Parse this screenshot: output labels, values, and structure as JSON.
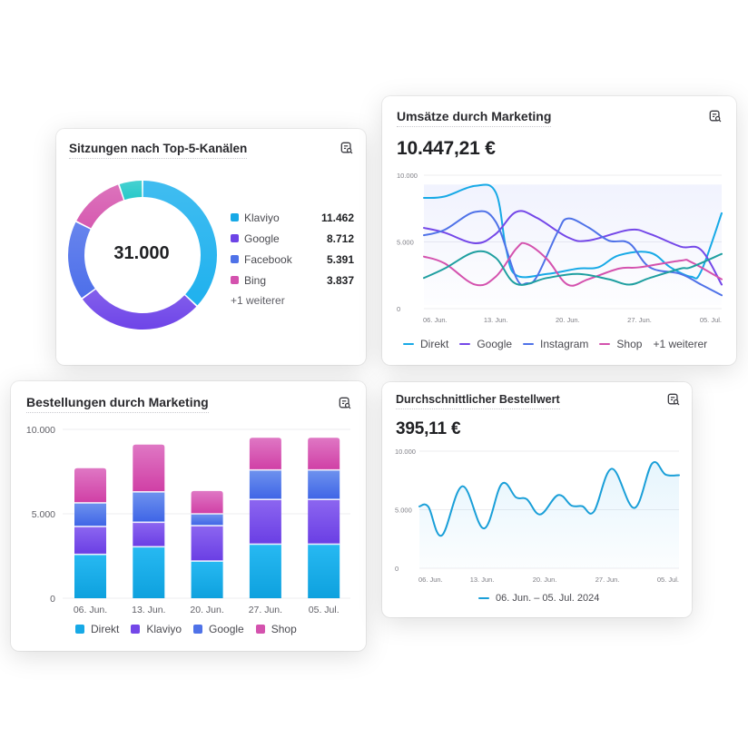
{
  "cards": {
    "donut": {
      "title": "Sitzungen nach Top-5-Kanälen",
      "icon": "report-search-icon",
      "total": "31.000",
      "legend": [
        {
          "label": "Klaviyo",
          "value": "11.462",
          "color": "#17a9e6"
        },
        {
          "label": "Google",
          "value": "8.712",
          "color": "#6d44e6"
        },
        {
          "label": "Facebook",
          "value": "5.391",
          "color": "#4f72e8"
        },
        {
          "label": "Bing",
          "value": "3.837",
          "color": "#d452ae"
        }
      ],
      "more_label": "+1 weiterer"
    },
    "revenue": {
      "title": "Umsätze durch Marketing",
      "icon": "report-search-icon",
      "value": "10.447,21 €",
      "legend": [
        {
          "label": "Direkt",
          "color": "#17a9e6"
        },
        {
          "label": "Google",
          "color": "#6d44e6"
        },
        {
          "label": "Instagram",
          "color": "#4f72e8"
        },
        {
          "label": "Shop",
          "color": "#d452ae"
        }
      ],
      "more_label": "+1 weiterer"
    },
    "orders": {
      "title": "Bestellungen durch Marketing",
      "icon": "report-search-icon",
      "legend": [
        {
          "label": "Direkt",
          "color": "#17a9e6"
        },
        {
          "label": "Klaviyo",
          "color": "#7447e8"
        },
        {
          "label": "Google",
          "color": "#4f72e8"
        },
        {
          "label": "Shop",
          "color": "#d452ae"
        }
      ]
    },
    "aov": {
      "title": "Durchschnittlicher Bestellwert",
      "icon": "report-search-icon",
      "value": "395,11 €",
      "legend_label": "06. Jun. – 05. Jul. 2024",
      "legend_color": "#1a9fd8"
    }
  },
  "chart_data": [
    {
      "id": "sessions-donut",
      "type": "pie",
      "title": "Sitzungen nach Top-5-Kanälen",
      "center_label": "31.000",
      "slices": [
        {
          "label": "Klaviyo",
          "value": 11462,
          "color": "#1fb1ee"
        },
        {
          "label": "Google",
          "value": 8712,
          "color": "#6e44e8"
        },
        {
          "label": "Facebook",
          "value": 5391,
          "color": "#4d6fea"
        },
        {
          "label": "Bing",
          "value": 3837,
          "color": "#d65ab0"
        },
        {
          "label": "Weitere",
          "value": 1598,
          "color": "#26c9c9"
        }
      ]
    },
    {
      "id": "revenue-lines",
      "type": "line",
      "title": "Umsätze durch Marketing",
      "xlabel": "",
      "ylabel": "",
      "x_range_days": [
        0,
        29
      ],
      "x_ticks": [
        {
          "day": 0,
          "label": "06. Jun."
        },
        {
          "day": 7,
          "label": "13. Jun."
        },
        {
          "day": 14,
          "label": "20. Jun."
        },
        {
          "day": 21,
          "label": "27. Jun."
        },
        {
          "day": 29,
          "label": "05. Jul."
        }
      ],
      "y_ticks": [
        {
          "value": 0,
          "label": "0"
        },
        {
          "value": 5000,
          "label": "5.000"
        },
        {
          "value": 10000,
          "label": "10.000"
        }
      ],
      "ylim": [
        0,
        10000
      ],
      "grid": true,
      "legend_position": "bottom",
      "series": [
        {
          "name": "Direkt",
          "color": "#17a9e6",
          "points": [
            [
              0,
              8300
            ],
            [
              2,
              8400
            ],
            [
              5,
              9200
            ],
            [
              7,
              8700
            ],
            [
              8,
              4500
            ],
            [
              9,
              2500
            ],
            [
              12,
              2600
            ],
            [
              15,
              3000
            ],
            [
              17,
              3100
            ],
            [
              19,
              4000
            ],
            [
              22,
              4200
            ],
            [
              24,
              3100
            ],
            [
              26,
              2400
            ],
            [
              27,
              2800
            ],
            [
              29,
              7150
            ]
          ]
        },
        {
          "name": "Google",
          "color": "#7447e8",
          "points": [
            [
              0,
              6050
            ],
            [
              2,
              5700
            ],
            [
              5,
              4900
            ],
            [
              7,
              5600
            ],
            [
              9,
              7250
            ],
            [
              11,
              6800
            ],
            [
              14,
              5350
            ],
            [
              16,
              5100
            ],
            [
              20,
              5900
            ],
            [
              22,
              5600
            ],
            [
              25,
              4650
            ],
            [
              27,
              4400
            ],
            [
              29,
              1800
            ]
          ]
        },
        {
          "name": "Instagram",
          "color": "#4f72e8",
          "points": [
            [
              0,
              5500
            ],
            [
              2,
              5900
            ],
            [
              5,
              7250
            ],
            [
              7,
              6500
            ],
            [
              9,
              2300
            ],
            [
              10,
              1900
            ],
            [
              11,
              2400
            ],
            [
              13,
              5700
            ],
            [
              14,
              6750
            ],
            [
              16,
              6100
            ],
            [
              18,
              5100
            ],
            [
              20,
              4900
            ],
            [
              22,
              3100
            ],
            [
              25,
              2600
            ],
            [
              27,
              1800
            ],
            [
              29,
              1000
            ]
          ]
        },
        {
          "name": "Shop",
          "color": "#d452ae",
          "points": [
            [
              0,
              3900
            ],
            [
              2,
              3400
            ],
            [
              5,
              1800
            ],
            [
              7,
              2400
            ],
            [
              9,
              4500
            ],
            [
              10,
              4850
            ],
            [
              12,
              3700
            ],
            [
              14,
              1800
            ],
            [
              16,
              2200
            ],
            [
              19,
              3000
            ],
            [
              21,
              3100
            ],
            [
              25,
              3600
            ],
            [
              26,
              3500
            ],
            [
              29,
              2200
            ]
          ]
        },
        {
          "name": "Weitere",
          "color": "#1f9fa0",
          "points": [
            [
              0,
              2300
            ],
            [
              2,
              3000
            ],
            [
              5,
              4250
            ],
            [
              7,
              3800
            ],
            [
              9,
              1850
            ],
            [
              12,
              2300
            ],
            [
              15,
              2600
            ],
            [
              18,
              2200
            ],
            [
              20,
              1800
            ],
            [
              22,
              2300
            ],
            [
              25,
              3000
            ],
            [
              26,
              3100
            ],
            [
              29,
              4100
            ]
          ]
        }
      ]
    },
    {
      "id": "orders-bars",
      "type": "bar",
      "stacked": true,
      "title": "Bestellungen durch Marketing",
      "categories": [
        "06. Jun.",
        "13. Jun.",
        "20. Jun.",
        "27. Jun.",
        "05. Jul."
      ],
      "y_ticks": [
        {
          "value": 0,
          "label": "0"
        },
        {
          "value": 5000,
          "label": "5.000"
        },
        {
          "value": 10000,
          "label": "10.000"
        }
      ],
      "ylim": [
        0,
        10000
      ],
      "grid": true,
      "legend_position": "bottom",
      "series": [
        {
          "name": "Direkt",
          "color_top": "#27b9f2",
          "color_bottom": "#0ea1de",
          "values": [
            2600,
            3050,
            2200,
            3200,
            3200
          ]
        },
        {
          "name": "Klaviyo",
          "color_top": "#8c66f0",
          "color_bottom": "#6a3ee4",
          "values": [
            1650,
            1450,
            2100,
            2650,
            2650
          ]
        },
        {
          "name": "Google",
          "color_top": "#6f93ee",
          "color_bottom": "#3e64e6",
          "values": [
            1400,
            1800,
            700,
            1750,
            1750
          ]
        },
        {
          "name": "Shop",
          "color_top": "#df77c4",
          "color_bottom": "#d03fa5",
          "values": [
            2050,
            2800,
            1350,
            1900,
            1900
          ]
        }
      ]
    },
    {
      "id": "aov-line",
      "type": "line",
      "title": "Durchschnittlicher Bestellwert",
      "x_range_days": [
        0,
        29
      ],
      "x_ticks": [
        {
          "day": 0,
          "label": "06. Jun."
        },
        {
          "day": 7,
          "label": "13. Jun."
        },
        {
          "day": 14,
          "label": "20. Jun."
        },
        {
          "day": 21,
          "label": "27. Jun."
        },
        {
          "day": 29,
          "label": "05. Jul."
        }
      ],
      "y_ticks": [
        {
          "value": 0,
          "label": "0"
        },
        {
          "value": 5000,
          "label": "5.000"
        },
        {
          "value": 10000,
          "label": "10.000"
        }
      ],
      "ylim": [
        0,
        10000
      ],
      "grid": true,
      "legend_position": "bottom",
      "series": [
        {
          "name": "06. Jun. – 05. Jul. 2024",
          "color": "#1a9fd8",
          "points": [
            [
              0,
              5280
            ],
            [
              1,
              5250
            ],
            [
              2.5,
              2800
            ],
            [
              4.8,
              7000
            ],
            [
              7.2,
              3400
            ],
            [
              9.2,
              7200
            ],
            [
              10.8,
              6050
            ],
            [
              12,
              5900
            ],
            [
              13.5,
              4600
            ],
            [
              15.5,
              6250
            ],
            [
              17,
              5350
            ],
            [
              18.2,
              5300
            ],
            [
              19.5,
              4850
            ],
            [
              21.5,
              8500
            ],
            [
              24,
              5150
            ],
            [
              26,
              8950
            ],
            [
              27.5,
              8000
            ],
            [
              29,
              7950
            ]
          ]
        }
      ]
    }
  ]
}
